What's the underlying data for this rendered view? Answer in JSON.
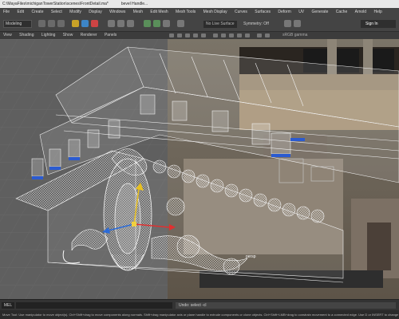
{
  "window": {
    "title_path": "C:\\MayaFiles\\michiganTowerStation\\scenes\\FrontDetail.ma*",
    "title_tab": "bevel Handle..."
  },
  "menubar": [
    "File",
    "Edit",
    "Create",
    "Select",
    "Modify",
    "Display",
    "Windows",
    "Mesh",
    "Edit Mesh",
    "Mesh Tools",
    "Mesh Display",
    "Curves",
    "Surfaces",
    "Deform",
    "UV",
    "Generate",
    "Cache",
    "Arnold",
    "Help"
  ],
  "shelf": {
    "mode": "Modeling",
    "live_surface": "No Live Surface",
    "symmetry": "Symmetry: Off",
    "sign_in": "Sign In"
  },
  "panel_menu": [
    "View",
    "Shading",
    "Lighting",
    "Show",
    "Renderer",
    "Panels"
  ],
  "viewport": {
    "camera_label": "persp",
    "gamma_value": "sRGB gamma"
  },
  "command_line": {
    "mel_label": "MEL",
    "result": "Undo: select -cl"
  },
  "help_line": "Move Tool: Use manipulator to move object(s). Ctrl+Shift+drag to move components along normals. Shift+drag manipulator axis or plane handle to extrude components or clone objects. Ctrl+Shift+LMB+drag to constrain movement to a connected edge. Use D or INSERT to change the pivot position and axis orientation.",
  "colors": {
    "viewport_bg": "#5f5f5f",
    "wire": "#f2f2f2",
    "highlight_blue": "#2b6bd8",
    "ui_bg": "#444444"
  },
  "icons": [
    "select-icon",
    "lasso-icon",
    "paint-icon",
    "move-icon",
    "rotate-icon",
    "scale-icon",
    "snap-grid-icon",
    "snap-curve-icon",
    "snap-point-icon",
    "render-icon"
  ]
}
